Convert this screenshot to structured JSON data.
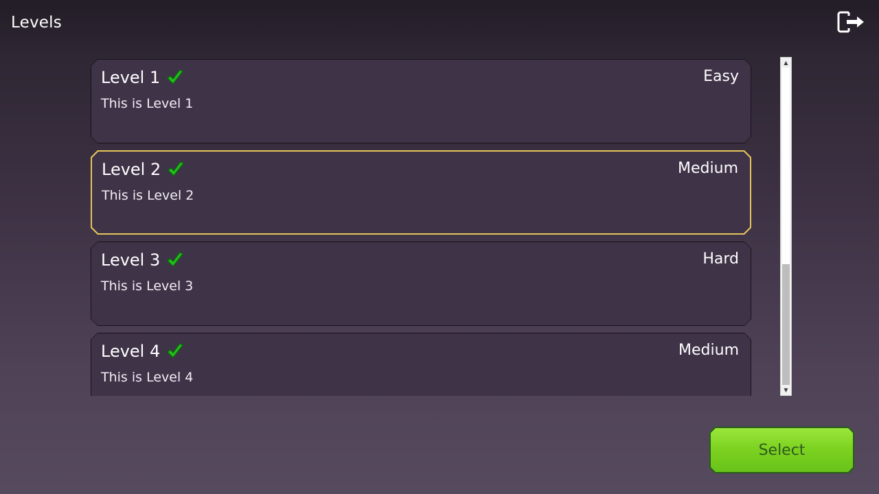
{
  "header": {
    "title": "Levels",
    "exit_icon": "exit-icon"
  },
  "levels": [
    {
      "name": "Level 1",
      "completed": true,
      "description": "This is Level 1",
      "difficulty": "Easy"
    },
    {
      "name": "Level 2",
      "completed": true,
      "description": "This is Level 2",
      "difficulty": "Medium"
    },
    {
      "name": "Level 3",
      "completed": true,
      "description": "This is Level 3",
      "difficulty": "Hard"
    },
    {
      "name": "Level 4",
      "completed": true,
      "description": "This is Level 4",
      "difficulty": "Medium"
    }
  ],
  "selected_level": "Level 2",
  "colors": {
    "selected_border": "#e7c65a",
    "check_green": "#22c21a",
    "button_green": "#7ed321"
  },
  "select_button": {
    "label": "Select"
  }
}
